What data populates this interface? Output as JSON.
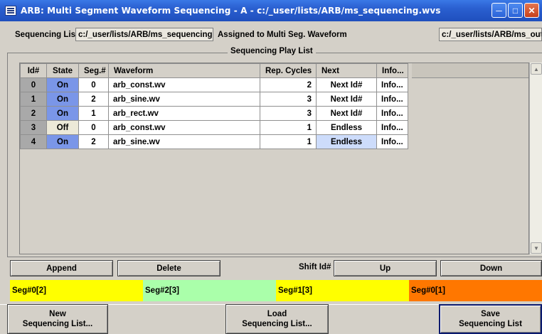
{
  "window": {
    "title": "ARB: Multi Segment Waveform Sequencing  -  A - c:/_user/lists/ARB/ms_sequencing.wvs",
    "controls": [
      "minimize-icon",
      "maximize-icon",
      "close-icon"
    ]
  },
  "sequencing": {
    "label": "Sequencing List",
    "path": "c:/_user/lists/ARB/ms_sequencing",
    "assigned_label": "Assigned to Multi Seg. Waveform",
    "assigned_path": "c:/_user/lists/ARB/ms_out"
  },
  "play_list": {
    "title": "Sequencing Play List",
    "columns": [
      "Id#",
      "State",
      "Seg.#",
      "Waveform",
      "Rep. Cycles",
      "Next",
      "Info..."
    ],
    "rows": [
      {
        "id": "0",
        "state": "On",
        "seg": "0",
        "waveform": "arb_const.wv",
        "rep": "2",
        "next": "Next Id#",
        "info": "Info..."
      },
      {
        "id": "1",
        "state": "On",
        "seg": "2",
        "waveform": "arb_sine.wv",
        "rep": "3",
        "next": "Next Id#",
        "info": "Info..."
      },
      {
        "id": "2",
        "state": "On",
        "seg": "1",
        "waveform": "arb_rect.wv",
        "rep": "3",
        "next": "Next Id#",
        "info": "Info..."
      },
      {
        "id": "3",
        "state": "Off",
        "seg": "0",
        "waveform": "arb_const.wv",
        "rep": "1",
        "next": "Endless",
        "info": "Info..."
      },
      {
        "id": "4",
        "state": "On",
        "seg": "2",
        "waveform": "arb_sine.wv",
        "rep": "1",
        "next": "Endless",
        "info": "Info..."
      }
    ]
  },
  "actions": {
    "append": "Append",
    "delete": "Delete",
    "shift_label": "Shift Id#",
    "up": "Up",
    "down": "Down"
  },
  "timeline": {
    "segments": [
      {
        "label": "Seg#0[2]",
        "color": "#ffff00"
      },
      {
        "label": "Seg#2[3]",
        "color": "#aaffaa"
      },
      {
        "label": "Seg#1[3]",
        "color": "#ffff00"
      },
      {
        "label": "Seg#0[1]",
        "color": "#ff7700"
      }
    ]
  },
  "footer": {
    "new_line1": "New",
    "new_line2": "Sequencing List...",
    "load_line1": "Load",
    "load_line2": "Sequencing List...",
    "save_line1": "Save",
    "save_line2": "Sequencing List"
  },
  "colors": {
    "state_on": "#7a96e8",
    "state_off": "#ece9d8",
    "next_selected": "#cddcfb",
    "titlebar": "#2a5fd0"
  }
}
